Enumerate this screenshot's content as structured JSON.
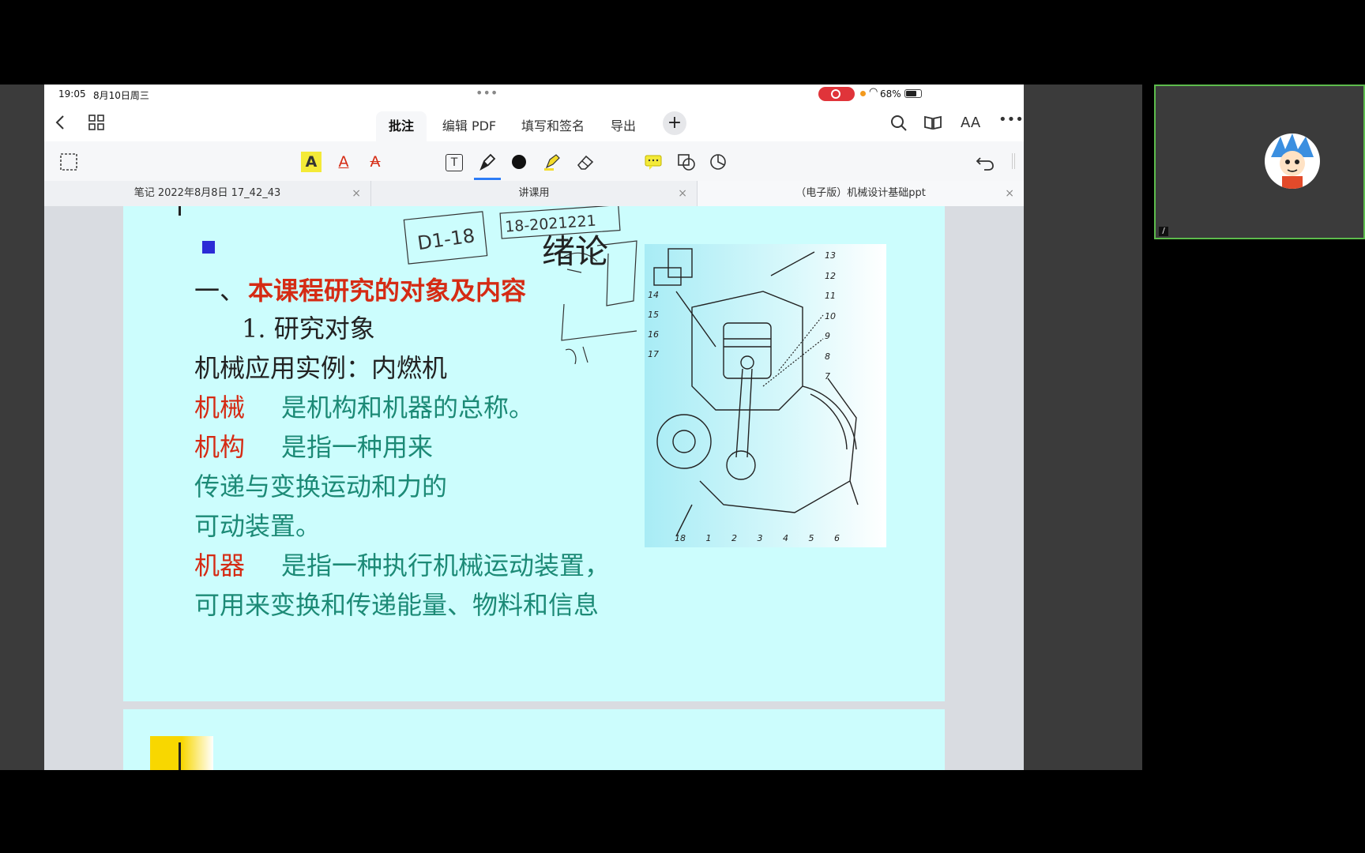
{
  "status": {
    "time": "19:05",
    "date": "8月10日周三",
    "battery": "68%",
    "dots": "•••"
  },
  "nav": {
    "back_icon": "chevron-left-icon",
    "tabs": [
      {
        "label": "批注",
        "active": true
      },
      {
        "label": "编辑 PDF",
        "active": false
      },
      {
        "label": "填写和签名",
        "active": false
      },
      {
        "label": "导出",
        "active": false
      }
    ],
    "add": "+",
    "aa": "AA",
    "more": "•••"
  },
  "doc_tabs": [
    {
      "label": "笔记 2022年8月8日 17_42_43",
      "close": "×"
    },
    {
      "label": "讲课用",
      "close": "×"
    },
    {
      "label": "（电子版）机械设计基础ppt",
      "close": "×"
    }
  ],
  "slide": {
    "title": "绪论",
    "heading_prefix": "一、",
    "heading": "本课程研究的对象及内容",
    "sub": "1.   研究对象",
    "example": "机械应用实例：内燃机",
    "term1": "机械",
    "def1": "是机构和机器的总称。",
    "term2": "机构",
    "def2a": "是指一种用来",
    "def2b": "传递与变换运动和力的",
    "def2c": "可动装置。",
    "term3": "机器",
    "def3a": "是指一种执行机械运动装置，",
    "def3b": "可用来变换和传递能量、物料和信息",
    "diagram_labels_right": [
      "13",
      "12",
      "11",
      "10",
      "9",
      "8",
      "7"
    ],
    "diagram_labels_left": [
      "14",
      "15",
      "16",
      "17"
    ],
    "diagram_labels_bottom": [
      "18",
      "1",
      "2",
      "3",
      "4",
      "5",
      "6"
    ]
  },
  "handwriting": {
    "a": "D1-18",
    "b": "18-2021221"
  },
  "colors": {
    "accent_red": "#d52b14",
    "teal": "#1c8a76",
    "slide_bg": "#ccfdfd",
    "video_border": "#5dbb4c"
  },
  "video": {
    "label": "/"
  }
}
